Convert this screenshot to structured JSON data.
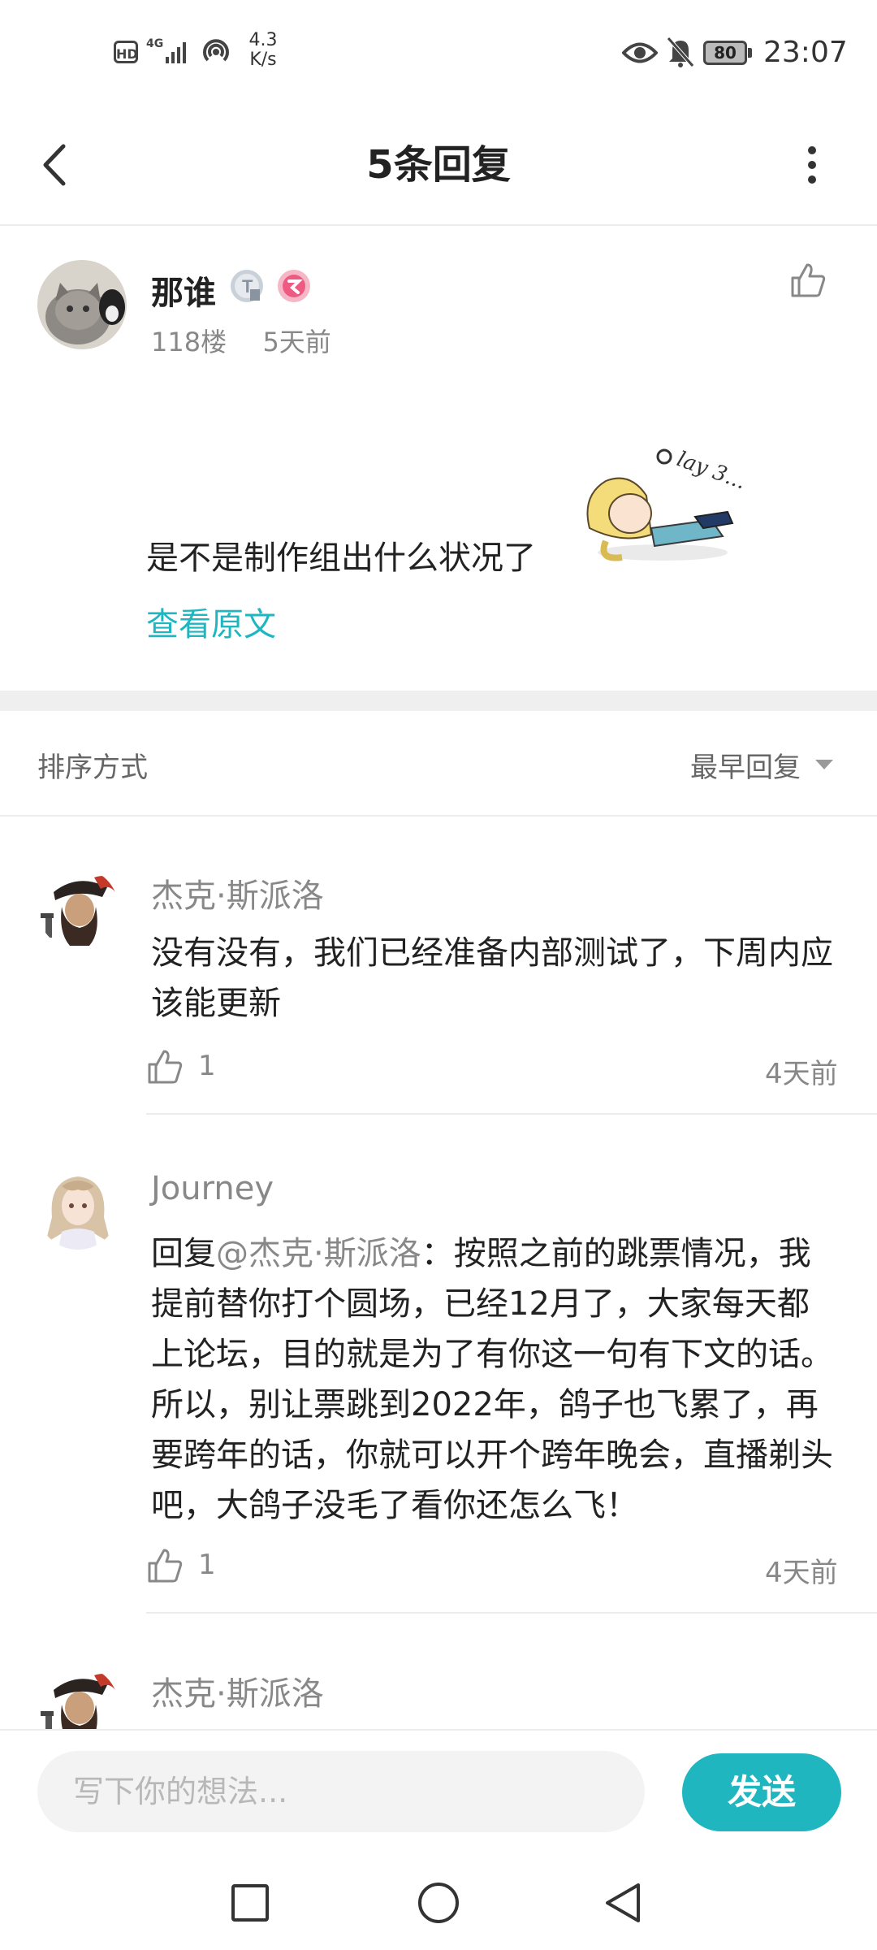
{
  "status_bar": {
    "network": "4G",
    "speed_value": "4.3",
    "speed_unit": "K/s",
    "battery": "80",
    "time": "23:07"
  },
  "header": {
    "title": "5条回复"
  },
  "post": {
    "username": "那谁",
    "floor": "118楼",
    "time": "5天前",
    "text": "是不是制作组出什么状况了",
    "view_original": "查看原文",
    "sticker_caption": "lay 3..."
  },
  "sort": {
    "label": "排序方式",
    "value": "最早回复"
  },
  "replies": [
    {
      "name": "杰克·斯派洛",
      "text": "没有没有，我们已经准备内部测试了，下周内应该能更新",
      "likes": "1",
      "time": "4天前"
    },
    {
      "name": "Journey",
      "reply_prefix": "回复",
      "mention": "@杰克·斯派洛",
      "text": "：按照之前的跳票情况，我提前替你打个圆场，已经12月了，大家每天都上论坛，目的就是为了有你这一句有下文的话。所以，别让票跳到2022年，鸽子也飞累了，再要跨年的话，你就可以开个跨年晚会，直播剃头吧，大鸽子没毛了看你还怎么飞！",
      "likes": "1",
      "time": "4天前"
    },
    {
      "name": "杰克·斯派洛"
    }
  ],
  "composer": {
    "placeholder": "写下你的想法...",
    "send_label": "发送"
  },
  "colors": {
    "accent": "#1fb6c0",
    "muted_text": "#888888",
    "divider": "#ececec"
  }
}
